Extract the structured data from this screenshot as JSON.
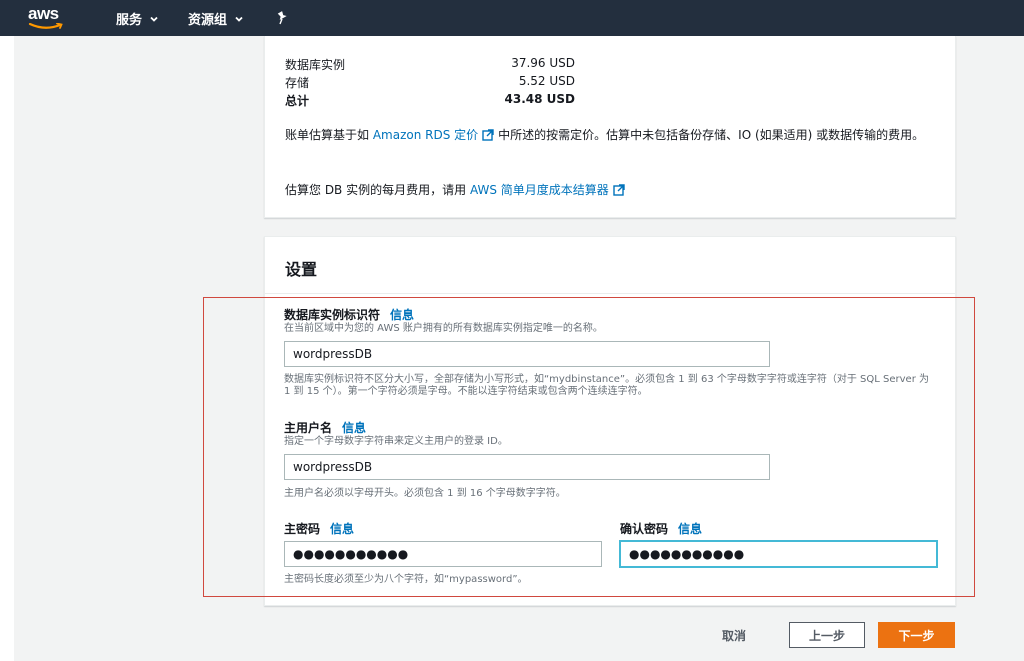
{
  "nav": {
    "logo": "aws",
    "services": "服务",
    "resource_groups": "资源组"
  },
  "cost": {
    "rows": [
      {
        "label": "数据库实例",
        "value": "37.96 USD"
      },
      {
        "label": "存储",
        "value": "5.52 USD"
      },
      {
        "label": "总计",
        "value": "43.48 USD"
      }
    ],
    "para1_a": "账单估算基于如",
    "para1_link": "Amazon RDS 定价",
    "para1_b": "中所述的按需定价。估算中未包括备份存储、IO (如果适用) 或数据传输的费用。",
    "para2_a": "估算您 DB 实例的每月费用，请用",
    "para2_link": "AWS 简单月度成本结算器"
  },
  "settings": {
    "title": "设置",
    "info": "信息",
    "identifier": {
      "label": "数据库实例标识符",
      "desc": "在当前区域中为您的 AWS 账户拥有的所有数据库实例指定唯一的名称。",
      "value": "wordpressDB",
      "hint": "数据库实例标识符不区分大小写，全部存储为小写形式，如“mydbinstance”。必须包含 1 到 63 个字母数字字符或连字符（对于 SQL Server 为 1 到 15 个）。第一个字符必须是字母。不能以连字符结束或包含两个连续连字符。"
    },
    "username": {
      "label": "主用户名",
      "desc": "指定一个字母数字字符串来定义主用户的登录 ID。",
      "value": "wordpressDB",
      "hint": "主用户名必须以字母开头。必须包含 1 到 16 个字母数字字符。"
    },
    "password": {
      "label": "主密码",
      "value": "●●●●●●●●●●●",
      "hint": "主密码长度必须至少为八个字符，如“mypassword”。"
    },
    "confirm": {
      "label": "确认密码",
      "value": "●●●●●●●●●●●"
    }
  },
  "footer": {
    "cancel": "取消",
    "prev": "上一步",
    "next": "下一步"
  },
  "colors": {
    "nav_bg": "#232f3e",
    "link": "#0073bb",
    "primary": "#ec7211",
    "annotation": "#d0483e"
  }
}
